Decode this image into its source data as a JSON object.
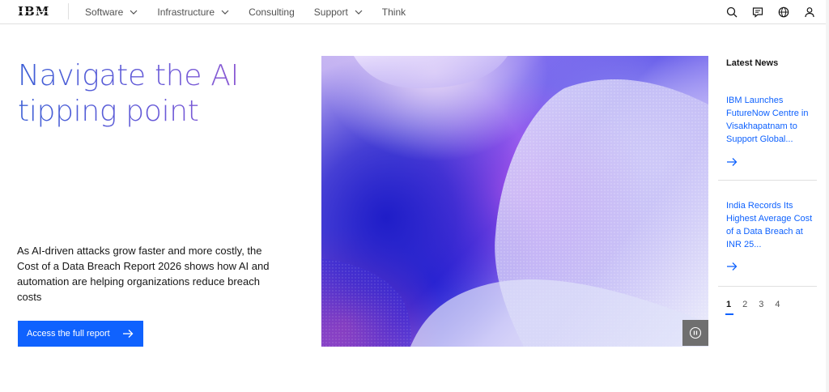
{
  "header": {
    "logo_text": "IBM",
    "nav": [
      {
        "label": "Software",
        "has_menu": true
      },
      {
        "label": "Infrastructure",
        "has_menu": true
      },
      {
        "label": "Consulting",
        "has_menu": false
      },
      {
        "label": "Support",
        "has_menu": true
      },
      {
        "label": "Think",
        "has_menu": false
      }
    ],
    "action_icons": [
      "search-icon",
      "chat-icon",
      "globe-icon",
      "user-icon"
    ]
  },
  "hero": {
    "title": "Navigate the AI tipping point",
    "description": "As AI-driven attacks grow faster and more costly, the Cost of a Data Breach Report 2026 shows how AI and automation are helping organizations reduce breach costs",
    "cta_label": "Access the full report",
    "image_icon": "pause-icon"
  },
  "news": {
    "title": "Latest News",
    "items": [
      {
        "headline": "IBM Launches FutureNow Centre in Visakhapatnam to Support Global..."
      },
      {
        "headline": "India Records Its Highest Average Cost of a Data Breach at INR 25..."
      }
    ],
    "pages": [
      "1",
      "2",
      "3",
      "4"
    ],
    "active_page": "1"
  },
  "colors": {
    "accent": "#0f62fe",
    "heading_gradient_start": "#3d5fd6",
    "heading_gradient_end": "#a15ad0"
  }
}
